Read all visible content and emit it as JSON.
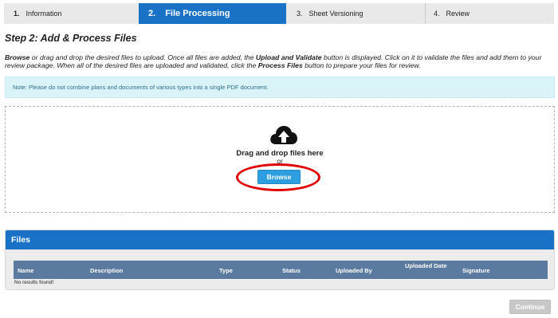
{
  "steps": [
    {
      "num": "1.",
      "label": "Information"
    },
    {
      "num": "2.",
      "label": "File Processing"
    },
    {
      "num": "3.",
      "label": "Sheet Versioning"
    },
    {
      "num": "4.",
      "label": "Review"
    }
  ],
  "heading": "Step 2: Add & Process Files",
  "instructions": {
    "part1": "Browse",
    "part2": " or drag and drop the desired files to upload. Once all files are added, the ",
    "part3": "Upload and Validate",
    "part4": " button is displayed. Click on it to validate the files and add them to your review package. When all of the desired files are uploaded and validated, click the ",
    "part5": "Process Files",
    "part6": " button to prepare your files for review."
  },
  "note": "Note: Please do not combine plans and documents of various types into a single PDF document.",
  "dropzone": {
    "icon": "cloud-upload-icon",
    "drag_text": "Drag and drop files here",
    "or_text": "or",
    "browse_label": "Browse"
  },
  "files": {
    "title": "Files",
    "columns": [
      "Name",
      "Description",
      "Type",
      "Status",
      "Uploaded By",
      "Uploaded Date",
      "Signature"
    ],
    "empty_text": "No results found!"
  },
  "continue_label": "Continue",
  "colors": {
    "active_step": "#1a72c7",
    "browse": "#2d9ee0",
    "highlight": "#e00000",
    "table_header": "#5a7aa0"
  }
}
